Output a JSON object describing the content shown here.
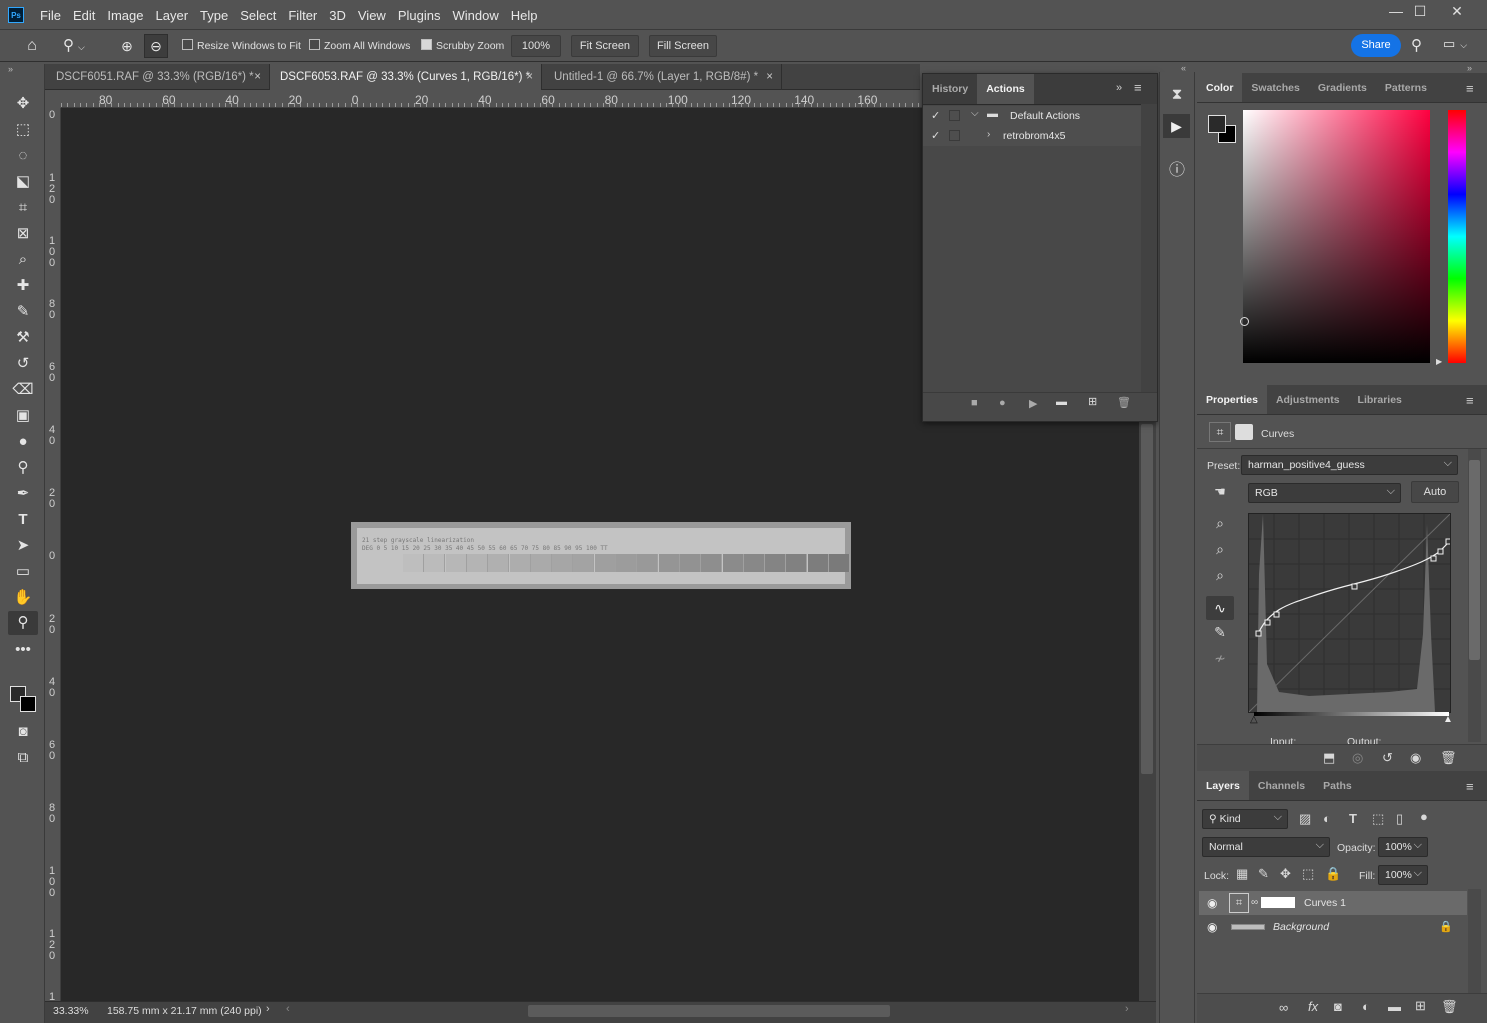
{
  "app": {
    "logo": "Ps"
  },
  "menu": [
    "File",
    "Edit",
    "Image",
    "Layer",
    "Type",
    "Select",
    "Filter",
    "3D",
    "View",
    "Plugins",
    "Window",
    "Help"
  ],
  "window_controls": {
    "minimize": "—",
    "maximize": "☐",
    "close": "✕"
  },
  "options": {
    "resize_windows": "Resize Windows to Fit",
    "zoom_all": "Zoom All Windows",
    "scrubby_zoom": "Scrubby Zoom",
    "zoom_value": "100%",
    "fit_screen": "Fit Screen",
    "fill_screen": "Fill Screen",
    "share": "Share"
  },
  "tabs": [
    {
      "label": "DSCF6051.RAF @ 33.3% (RGB/16*) *",
      "close": "×"
    },
    {
      "label": "DSCF6053.RAF @ 33.3% (Curves 1, RGB/16*) *",
      "close": "×"
    },
    {
      "label": "Untitled-1 @ 66.7% (Layer 1, RGB/8#) *",
      "close": "×"
    }
  ],
  "ruler_h": [
    "80",
    "60",
    "40",
    "20",
    "0",
    "20",
    "40",
    "60",
    "80",
    "100",
    "120",
    "140",
    "160"
  ],
  "ruler_v": [
    "0",
    "120",
    "100",
    "80",
    "60",
    "40",
    "20",
    "0",
    "20",
    "40",
    "60",
    "80",
    "100",
    "120",
    "140"
  ],
  "document": {
    "label_title": "21 step grayscale linearization",
    "label_numbers": "DEG  0   5   10   15  20  25  30   35   40   45   50   55   60   65   70   75   80   85   90   95   100  TT"
  },
  "status": {
    "zoom": "33.33%",
    "dims": "158.75 mm x 21.17 mm (240 ppi)"
  },
  "actions_panel": {
    "tabs": [
      "History",
      "Actions"
    ],
    "items": [
      {
        "label": "Default Actions"
      },
      {
        "label": "retrobrom4x5"
      }
    ]
  },
  "color_panel": {
    "tabs": [
      "Color",
      "Swatches",
      "Gradients",
      "Patterns"
    ]
  },
  "properties_panel": {
    "tabs": [
      "Properties",
      "Adjustments",
      "Libraries"
    ],
    "title": "Curves",
    "preset_label": "Preset:",
    "preset_value": "harman_positive4_guess",
    "channel": "RGB",
    "auto": "Auto",
    "input_label": "Input:",
    "output_label": "Output:"
  },
  "layers_panel": {
    "tabs": [
      "Layers",
      "Channels",
      "Paths"
    ],
    "kind": "Kind",
    "blend": "Normal",
    "opacity_label": "Opacity:",
    "opacity": "100%",
    "lock_label": "Lock:",
    "fill_label": "Fill:",
    "fill": "100%",
    "layers": [
      {
        "name": "Curves 1"
      },
      {
        "name": "Background"
      }
    ]
  }
}
